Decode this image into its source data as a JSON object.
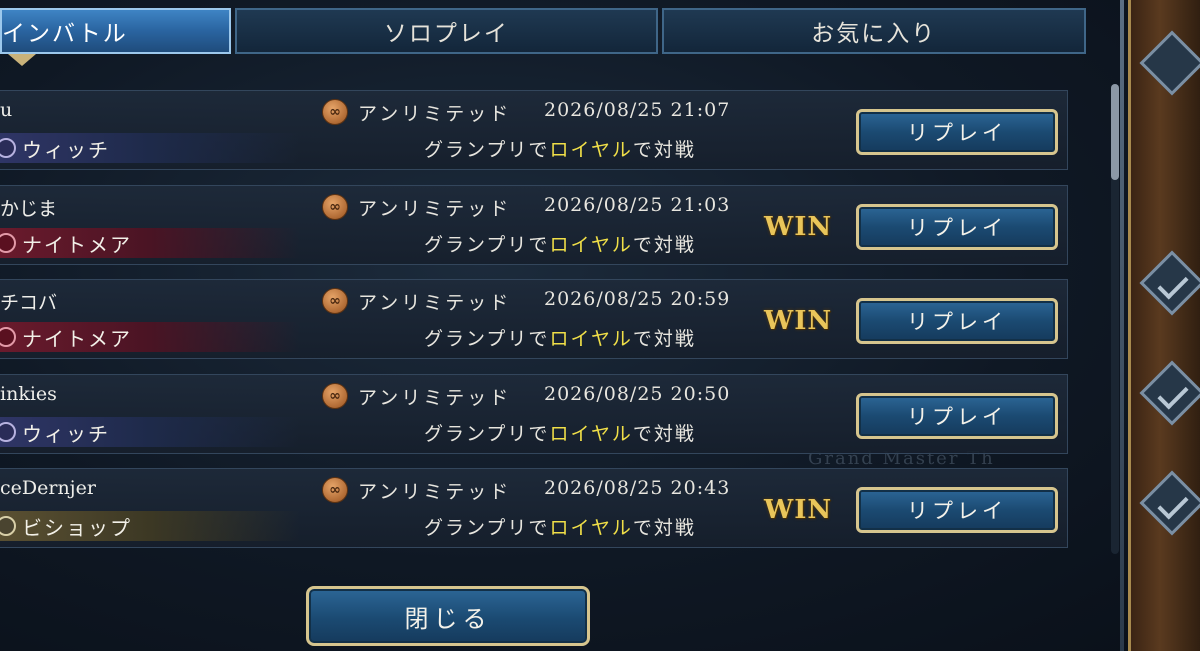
{
  "tabs": [
    {
      "label": "インバトル",
      "active": true
    },
    {
      "label": "ソロプレイ",
      "active": false
    },
    {
      "label": "お気に入り",
      "active": false
    }
  ],
  "matches": [
    {
      "player": "u",
      "class": "ウィッチ",
      "class_key": "witch",
      "format": "アンリミテッド",
      "datetime": "2026/08/25 21:07",
      "desc_pre": "グランプリで",
      "desc_hl": "ロイヤル",
      "desc_post": "で対戦",
      "result": "",
      "replay": "リプレイ"
    },
    {
      "player": "かじま",
      "class": "ナイトメア",
      "class_key": "nightmare",
      "format": "アンリミテッド",
      "datetime": "2026/08/25 21:03",
      "desc_pre": "グランプリで",
      "desc_hl": "ロイヤル",
      "desc_post": "で対戦",
      "result": "WIN",
      "replay": "リプレイ"
    },
    {
      "player": "チコバ",
      "class": "ナイトメア",
      "class_key": "nightmare",
      "format": "アンリミテッド",
      "datetime": "2026/08/25 20:59",
      "desc_pre": "グランプリで",
      "desc_hl": "ロイヤル",
      "desc_post": "で対戦",
      "result": "WIN",
      "replay": "リプレイ"
    },
    {
      "player": "inkies",
      "class": "ウィッチ",
      "class_key": "witch",
      "format": "アンリミテッド",
      "datetime": "2026/08/25 20:50",
      "desc_pre": "グランプリで",
      "desc_hl": "ロイヤル",
      "desc_post": "で対戦",
      "result": "",
      "replay": "リプレイ"
    },
    {
      "player": "ceDernjer",
      "class": "ビショップ",
      "class_key": "bishop",
      "format": "アンリミテッド",
      "datetime": "2026/08/25 20:43",
      "desc_pre": "グランプリで",
      "desc_hl": "ロイヤル",
      "desc_post": "で対戦",
      "result": "WIN",
      "replay": "リプレイ"
    }
  ],
  "background_text": "Grand Master Th",
  "close_label": "閉じる",
  "colors": {
    "accent_gold": "#d6c58e",
    "win_gold": "#e9c55a",
    "highlight_yellow": "#f0df48",
    "button_blue": "#1b4a72"
  },
  "icons": {
    "format": "infinity-icon",
    "class": "class-emblem-icon"
  }
}
